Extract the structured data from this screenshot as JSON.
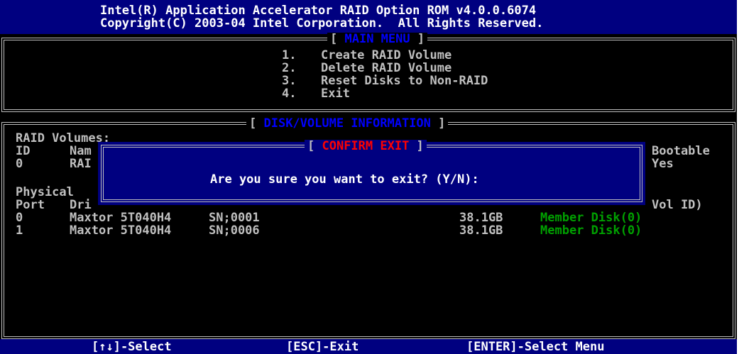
{
  "header": {
    "line1": "Intel(R) Application Accelerator RAID Option ROM v4.0.0.6074",
    "line2": "Copyright(C) 2003-04 Intel Corporation.  All Rights Reserved."
  },
  "main_menu": {
    "title": "MAIN MENU",
    "items": [
      {
        "number": "1.",
        "label": "Create RAID Volume"
      },
      {
        "number": "2.",
        "label": "Delete RAID Volume"
      },
      {
        "number": "3.",
        "label": "Reset Disks to Non-RAID"
      },
      {
        "number": "4.",
        "label": "Exit"
      }
    ]
  },
  "disk_info": {
    "title": "DISK/VOLUME INFORMATION",
    "raid_volumes_label": "RAID Volumes:",
    "vol_header_id": "ID",
    "vol_header_name": "Nam",
    "vol_header_bootable": "Bootable",
    "volume": {
      "id": "0",
      "name": "RAI",
      "bootable": "Yes"
    },
    "physical_label": "Physical",
    "disk_header_port": "Port",
    "disk_header_drive": "Dri",
    "disk_header_volid": "Vol ID)",
    "disks": [
      {
        "port": "0",
        "model": "Maxtor 5T040H4",
        "serial": "SN;0001",
        "size": "38.1GB",
        "type": "Member Disk(0)"
      },
      {
        "port": "1",
        "model": "Maxtor 5T040H4",
        "serial": "SN;0006",
        "size": "38.1GB",
        "type": "Member Disk(0)"
      }
    ]
  },
  "dialog": {
    "title": "CONFIRM EXIT",
    "message": "Are you sure you want to exit? (Y/N):"
  },
  "footer": {
    "select": "[↑↓]-Select",
    "exit": "[ESC]-Exit",
    "enter": "[ENTER]-Select Menu"
  },
  "colors": {
    "header_bg": "#000080",
    "title_text": "#0000ff",
    "dialog_title": "#ff0000",
    "member_disk": "#00a000"
  }
}
